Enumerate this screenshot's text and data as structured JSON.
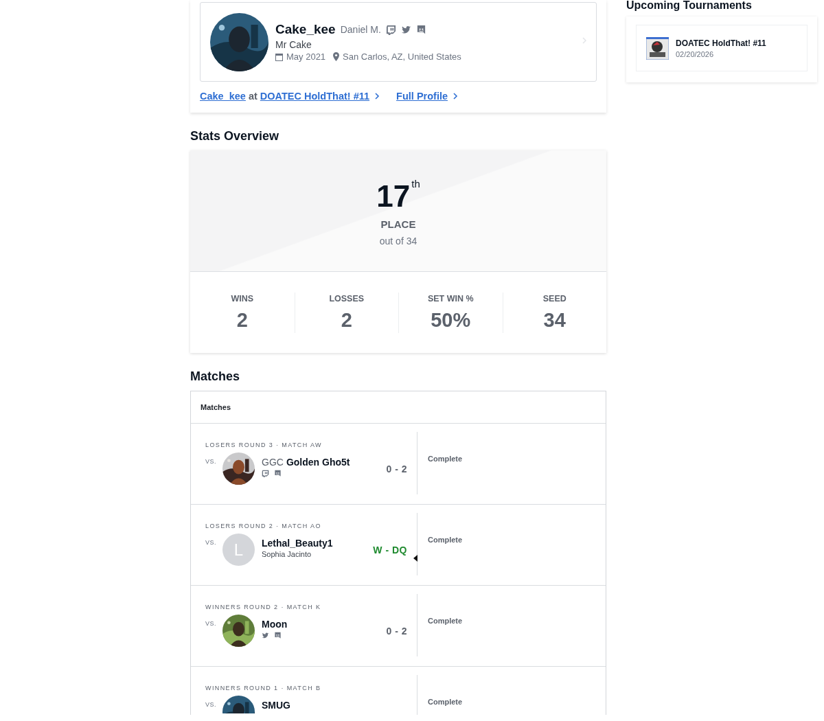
{
  "profile": {
    "gamer_tag": "Cake_kee",
    "real_name": "Daniel M.",
    "socials": [
      {
        "kind": "twitch"
      },
      {
        "kind": "twitter"
      },
      {
        "kind": "discord"
      }
    ],
    "bio": "Mr Cake",
    "joined": "May 2021",
    "location": "San Carlos, AZ, United States"
  },
  "links": {
    "event_player": "Cake_kee",
    "event_joiner": "at",
    "event_name": "DOATEC HoldThat! #11",
    "full_profile": "Full Profile"
  },
  "stats_overview": {
    "title": "Stats Overview",
    "placement": "17$^{th}$",
    "placement_label": "PLACE",
    "out_of": "out of 34",
    "stats": [
      {
        "label": "WINS",
        "value": "2"
      },
      {
        "label": "LOSSES",
        "value": "2"
      },
      {
        "label": "SET WIN %",
        "value": "50%"
      },
      {
        "label": "SEED",
        "value": "34"
      }
    ]
  },
  "matches": {
    "title": "Matches",
    "header": "Matches",
    "rows": [
      {
        "round": "LOSERS ROUND 3 · MATCH AW",
        "vs": "VS.",
        "avatar": {
          "kind": "picture"
        },
        "prefix": "GGC",
        "name": "Golden Gho5t",
        "socials": [
          {
            "kind": "twitch"
          },
          {
            "kind": "discord"
          }
        ],
        "score": "0 - 2",
        "winner": false,
        "status": "Complete"
      },
      {
        "round": "LOSERS ROUND 2 · MATCH AO",
        "vs": "VS.",
        "avatar": {
          "kind": "letter",
          "letter": "L"
        },
        "name": "Lethal_Beauty1",
        "real_name": "Sophia Jacinto",
        "score": "W - DQ",
        "winner": true,
        "status": "Complete"
      },
      {
        "round": "WINNERS ROUND 2 · MATCH K",
        "vs": "VS.",
        "avatar": {
          "kind": "picture"
        },
        "name": "Moon",
        "socials": [
          {
            "kind": "twitter"
          },
          {
            "kind": "discord"
          }
        ],
        "score": "0 - 2",
        "winner": false,
        "status": "Complete"
      },
      {
        "round": "WINNERS ROUND 1 · MATCH B",
        "vs": "VS.",
        "avatar": {
          "kind": "picture"
        },
        "name": "SMUG",
        "status": "Complete"
      }
    ]
  },
  "upcoming": {
    "title": "Upcoming Tournaments",
    "items": [
      {
        "name": "DOATEC HoldThat! #11",
        "date": "02/20/2026"
      }
    ]
  }
}
